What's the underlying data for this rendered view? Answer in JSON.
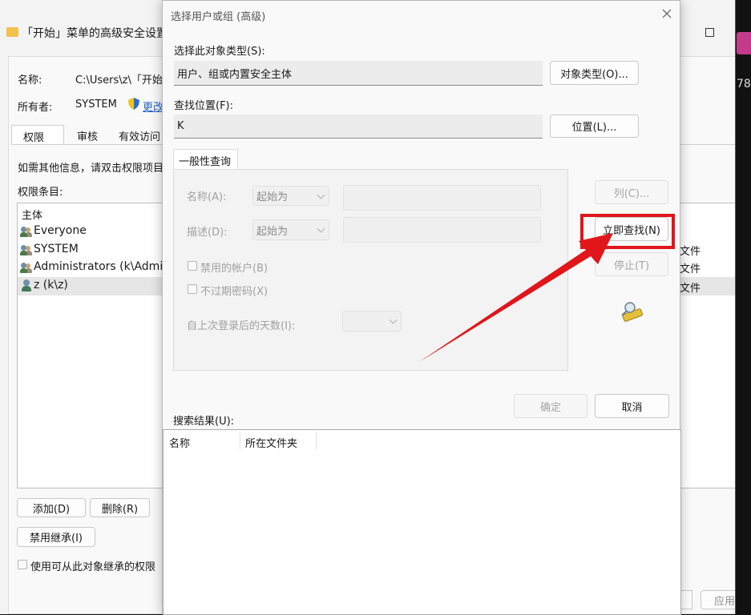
{
  "background_window": {
    "title": "「开始」菜单的高级安全设置",
    "name_label": "名称:",
    "name_value": "C:\\Users\\z\\「开始",
    "owner_label": "所有者:",
    "owner_value": "SYSTEM",
    "change_link": "更改",
    "tabs": [
      "权限",
      "审核",
      "有效访问"
    ],
    "info_text": "如需其他信息，请双击权限项目",
    "entries_label": "权限条目:",
    "column_principal": "主体",
    "entries": [
      {
        "name": "Everyone",
        "access": "文件"
      },
      {
        "name": "SYSTEM",
        "access": "文件"
      },
      {
        "name": "Administrators (k\\Admini",
        "access": "文件"
      },
      {
        "name": "z (k\\z)",
        "access": "文件"
      }
    ],
    "add_button": "添加(D)",
    "remove_button": "删除(R)",
    "disable_inherit_button": "禁用继承(I)",
    "inherit_checkbox_label": "使用可从此对象继承的权限",
    "apply_button": "应用",
    "right_edge_text": "78"
  },
  "dialog": {
    "title": "选择用户或组 (高级)",
    "object_type_label": "选择此对象类型(S):",
    "object_type_value": "用户、组或内置安全主体",
    "object_type_button": "对象类型(O)...",
    "location_label": "查找位置(F):",
    "location_value": "K",
    "location_button": "位置(L)...",
    "group_tab": "一般性查询",
    "name_label": "名称(A):",
    "name_mode": "起始为",
    "desc_label": "描述(D):",
    "desc_mode": "起始为",
    "disabled_accounts_label": "禁用的帐户(B)",
    "no_expire_label": "不过期密码(X)",
    "days_label": "自上次登录后的天数(I):",
    "columns_button": "列(C)...",
    "find_now_button": "立即查找(N)",
    "stop_button": "停止(T)",
    "ok_button": "确定",
    "cancel_button": "取消",
    "results_label": "搜索结果(U):",
    "results_columns": [
      "名称",
      "所在文件夹"
    ]
  },
  "colors": {
    "highlight": "#e0161a",
    "dialog_bg": "#f9f9f9",
    "window_bg": "#f3f3f3"
  }
}
